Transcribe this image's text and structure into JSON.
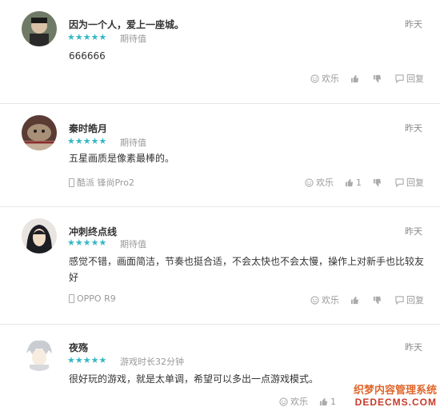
{
  "reviews": [
    {
      "user": "因为一个人，爱上一座城。",
      "time": "昨天",
      "stars": "★★★★★",
      "tag": "期待值",
      "text": "666666",
      "device": "",
      "like_count": "",
      "actions": {
        "fun": "欢乐",
        "reply": "回复"
      }
    },
    {
      "user": "秦时皓月",
      "time": "昨天",
      "stars": "★★★★★",
      "tag": "期待值",
      "text": "五星画质是像素最棒的。",
      "device": "酷派 锋尚Pro2",
      "like_count": "1",
      "actions": {
        "fun": "欢乐",
        "reply": "回复"
      }
    },
    {
      "user": "冲刺终点线",
      "time": "昨天",
      "stars": "★★★★★",
      "tag": "期待值",
      "text": "感觉不错，画面简洁，节奏也挺合适，不会太快也不会太慢，操作上对新手也比较友好",
      "device": "OPPO R9",
      "like_count": "",
      "actions": {
        "fun": "欢乐",
        "reply": "回复"
      }
    },
    {
      "user": "夜殇",
      "time": "昨天",
      "stars": "★★★★★",
      "tag": "游戏时长32分钟",
      "text": "很好玩的游戏，就是太单调，希望可以多出一点游戏模式。",
      "device": "",
      "like_count": "",
      "actions": {
        "fun": "欢乐",
        "like": "1"
      }
    }
  ],
  "watermark": {
    "line1": "织梦内容管理系统",
    "line2": "DEDECMS.COM"
  },
  "colors": {
    "star": "#35b8c6",
    "divider": "#e6e6e6"
  }
}
